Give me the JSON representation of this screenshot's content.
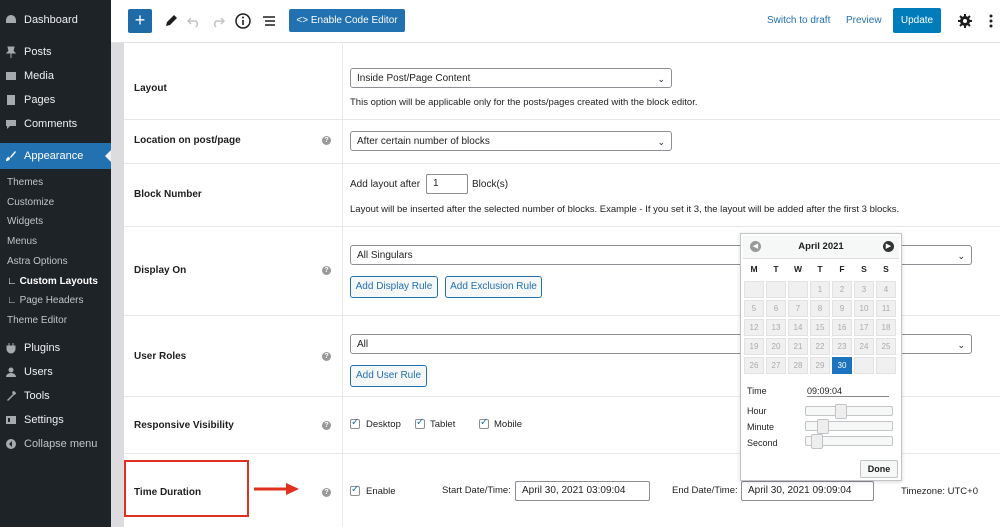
{
  "sidebar": {
    "items": [
      {
        "label": "Dashboard",
        "icon": "dashboard-icon"
      },
      {
        "label": "Posts",
        "icon": "pin-icon"
      },
      {
        "label": "Media",
        "icon": "media-icon"
      },
      {
        "label": "Pages",
        "icon": "pages-icon"
      },
      {
        "label": "Comments",
        "icon": "comments-icon"
      },
      {
        "label": "Appearance",
        "icon": "brush-icon"
      },
      {
        "label": "Plugins",
        "icon": "plugin-icon"
      },
      {
        "label": "Users",
        "icon": "users-icon"
      },
      {
        "label": "Tools",
        "icon": "tools-icon"
      },
      {
        "label": "Settings",
        "icon": "settings-icon"
      },
      {
        "label": "Collapse menu",
        "icon": "collapse-icon"
      }
    ],
    "submenu": [
      "Themes",
      "Customize",
      "Widgets",
      "Menus",
      "Astra Options",
      "Custom Layouts",
      "Page Headers",
      "Theme Editor"
    ]
  },
  "toolbar": {
    "code_editor_label": "Enable Code Editor",
    "switch_draft_label": "Switch to draft",
    "preview_label": "Preview",
    "update_label": "Update"
  },
  "rows": {
    "layout": {
      "label": "Layout",
      "value": "Inside Post/Page Content",
      "desc": "This option will be applicable only for the posts/pages created with the block editor."
    },
    "location": {
      "label": "Location on post/page",
      "value": "After certain number of blocks"
    },
    "block_number": {
      "label": "Block Number",
      "prefix": "Add layout after",
      "value": "1",
      "suffix": "Block(s)",
      "desc": "Layout will be inserted after the selected number of blocks. Example - If you set it 3, the layout will be added after the first 3 blocks."
    },
    "display_on": {
      "label": "Display On",
      "value": "All Singulars",
      "add_display_rule": "Add Display Rule",
      "add_exclusion_rule": "Add Exclusion Rule"
    },
    "user_roles": {
      "label": "User Roles",
      "value": "All",
      "add_user_rule": "Add User Rule"
    },
    "responsive": {
      "label": "Responsive Visibility",
      "desktop": "Desktop",
      "tablet": "Tablet",
      "mobile": "Mobile"
    },
    "time_duration": {
      "label": "Time Duration",
      "enable": "Enable",
      "start_label": "Start Date/Time:",
      "start_value": "April 30, 2021 03:09:04",
      "end_label": "End Date/Time:",
      "end_value": "April 30, 2021 09:09:04",
      "timezone": "Timezone: UTC+0"
    }
  },
  "datepicker": {
    "title": "April 2021",
    "weekdays": [
      "M",
      "T",
      "W",
      "T",
      "F",
      "S",
      "S"
    ],
    "days": [
      [
        "",
        "",
        "",
        "1",
        "2",
        "3",
        "4"
      ],
      [
        "5",
        "6",
        "7",
        "8",
        "9",
        "10",
        "11"
      ],
      [
        "12",
        "13",
        "14",
        "15",
        "16",
        "17",
        "18"
      ],
      [
        "19",
        "20",
        "21",
        "22",
        "23",
        "24",
        "25"
      ],
      [
        "26",
        "27",
        "28",
        "29",
        "30",
        "",
        ""
      ]
    ],
    "selected": "30",
    "time_label": "Time",
    "time_value": "09:09:04",
    "hour_label": "Hour",
    "minute_label": "Minute",
    "second_label": "Second",
    "hour_level": 0.375,
    "minute_level": 0.15,
    "second_level": 0.07,
    "done_label": "Done"
  },
  "colors": {
    "accent": "#2271b1",
    "sidebar": "#1d2327",
    "highlight": "#e0301e"
  }
}
